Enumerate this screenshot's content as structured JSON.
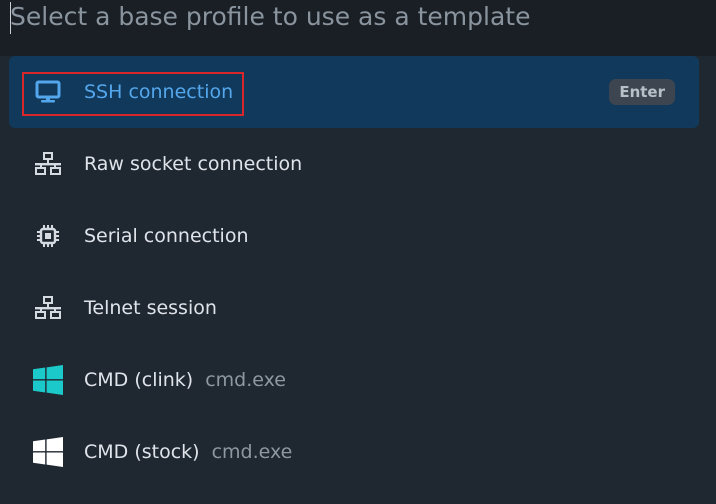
{
  "search": {
    "placeholder": "Select a base profile to use as a template",
    "value": ""
  },
  "colors": {
    "background": "#1f2730",
    "search_background": "#1a1f25",
    "active_item_background": "#11395b",
    "active_text": "#54a7ec",
    "highlight_border": "#d82629",
    "clink_icon": "#1bc9ca",
    "stock_icon": "#ffffff"
  },
  "items": [
    {
      "label": "SSH connection",
      "description": "",
      "icon": "monitor-icon",
      "shortcut": "Enter",
      "active": true
    },
    {
      "label": "Raw socket connection",
      "description": "",
      "icon": "network-icon"
    },
    {
      "label": "Serial connection",
      "description": "",
      "icon": "chip-icon"
    },
    {
      "label": "Telnet session",
      "description": "",
      "icon": "network-icon"
    },
    {
      "label": "CMD (clink)",
      "description": "cmd.exe",
      "icon": "windows-logo-icon"
    },
    {
      "label": "CMD (stock)",
      "description": "cmd.exe",
      "icon": "windows-logo-icon"
    }
  ]
}
